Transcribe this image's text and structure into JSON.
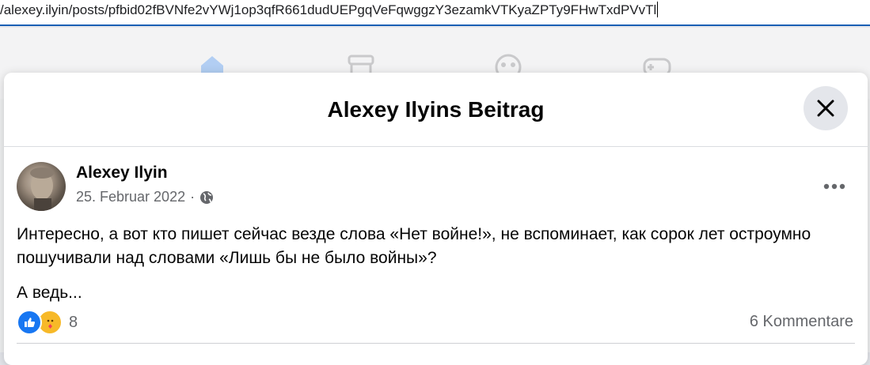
{
  "browser": {
    "url": "/alexey.ilyin/posts/pfbid02fBVNfe2vYWj1op3qfR661dudUEPgqVeFqwggzY3ezamkVTKyaZPTy9FHwTxdPVvTl"
  },
  "nav_icons": [
    "home-icon",
    "marketplace-icon",
    "groups-icon",
    "gaming-icon"
  ],
  "modal": {
    "title": "Alexey Ilyins Beitrag",
    "close_label": "×"
  },
  "post": {
    "author": "Alexey Ilyin",
    "date": "25. Februar 2022",
    "separator": "·",
    "paragraphs": [
      "Интересно, а вот кто пишет сейчас везде слова «Нет войне!», не вспоминает, как сорок лет остроумно пошучивали над словами «Лишь бы не было войны»?",
      "А ведь..."
    ],
    "reaction_count": "8",
    "comments": "6 Kommentare"
  },
  "colors": {
    "accent": "#1877f2",
    "secondary_text": "#65676b",
    "care_yellow": "#f7b928"
  }
}
